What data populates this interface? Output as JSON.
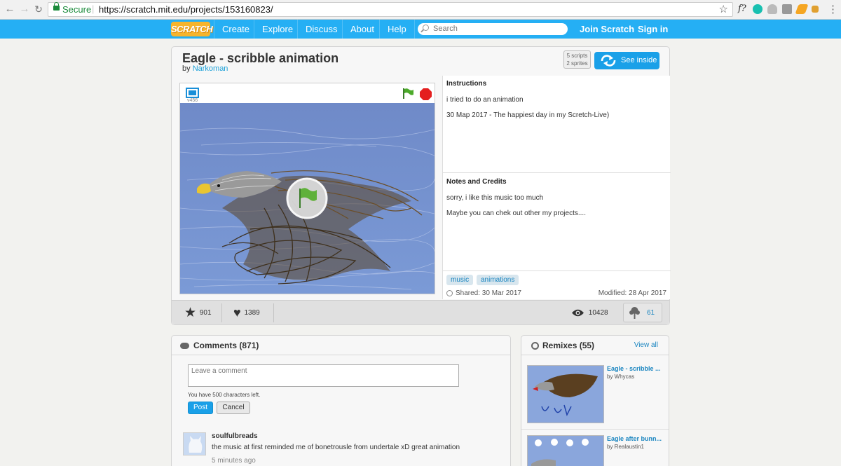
{
  "browser": {
    "secure_label": "Secure",
    "url": "https://scratch.mit.edu/projects/153160823/"
  },
  "nav": {
    "logo": "SCRATCH",
    "items": [
      "Create",
      "Explore",
      "Discuss",
      "About",
      "Help"
    ],
    "search_placeholder": "Search",
    "join": "Join Scratch",
    "signin": "Sign in"
  },
  "project": {
    "title": "Eagle - scribble animation",
    "by": "by",
    "author": "Narkoman",
    "scripts": "5 scripts",
    "sprites": "2 sprites",
    "see_inside": "See inside",
    "player_version": "v456",
    "instructions_heading": "Instructions",
    "instructions": [
      "i tried to do an animation",
      "30 Map 2017 - The happiest day in my Scretch-Live)"
    ],
    "notes_heading": "Notes and Credits",
    "notes": [
      "sorry, i like this music too much",
      "Maybe you can chek out other my projects...."
    ],
    "tags": [
      "music",
      "animations"
    ],
    "shared": "Shared: 30 Mar 2017",
    "modified": "Modified: 28 Apr 2017",
    "favorites": "901",
    "loves": "1389",
    "views": "10428",
    "remix_count": "61"
  },
  "comments": {
    "heading": "Comments (871)",
    "placeholder": "Leave a comment",
    "chars_left": "You have 500 characters left.",
    "post": "Post",
    "cancel": "Cancel",
    "items": [
      {
        "user": "soulfulbreads",
        "text": "the music at first reminded me of bonetrousle from undertale xD great animation",
        "time": "5 minutes ago"
      }
    ]
  },
  "remixes": {
    "heading": "Remixes (55)",
    "view_all": "View all",
    "items": [
      {
        "title": "Eagle - scribble ...",
        "by": "by Whycas"
      },
      {
        "title": "Eagle after bunn...",
        "by": "by Realaustin1"
      }
    ]
  },
  "colors": {
    "nav": "#25aff4",
    "link": "#1aa0d8",
    "accent_button": "#1aa0e8",
    "logo": "#f7b42c"
  }
}
